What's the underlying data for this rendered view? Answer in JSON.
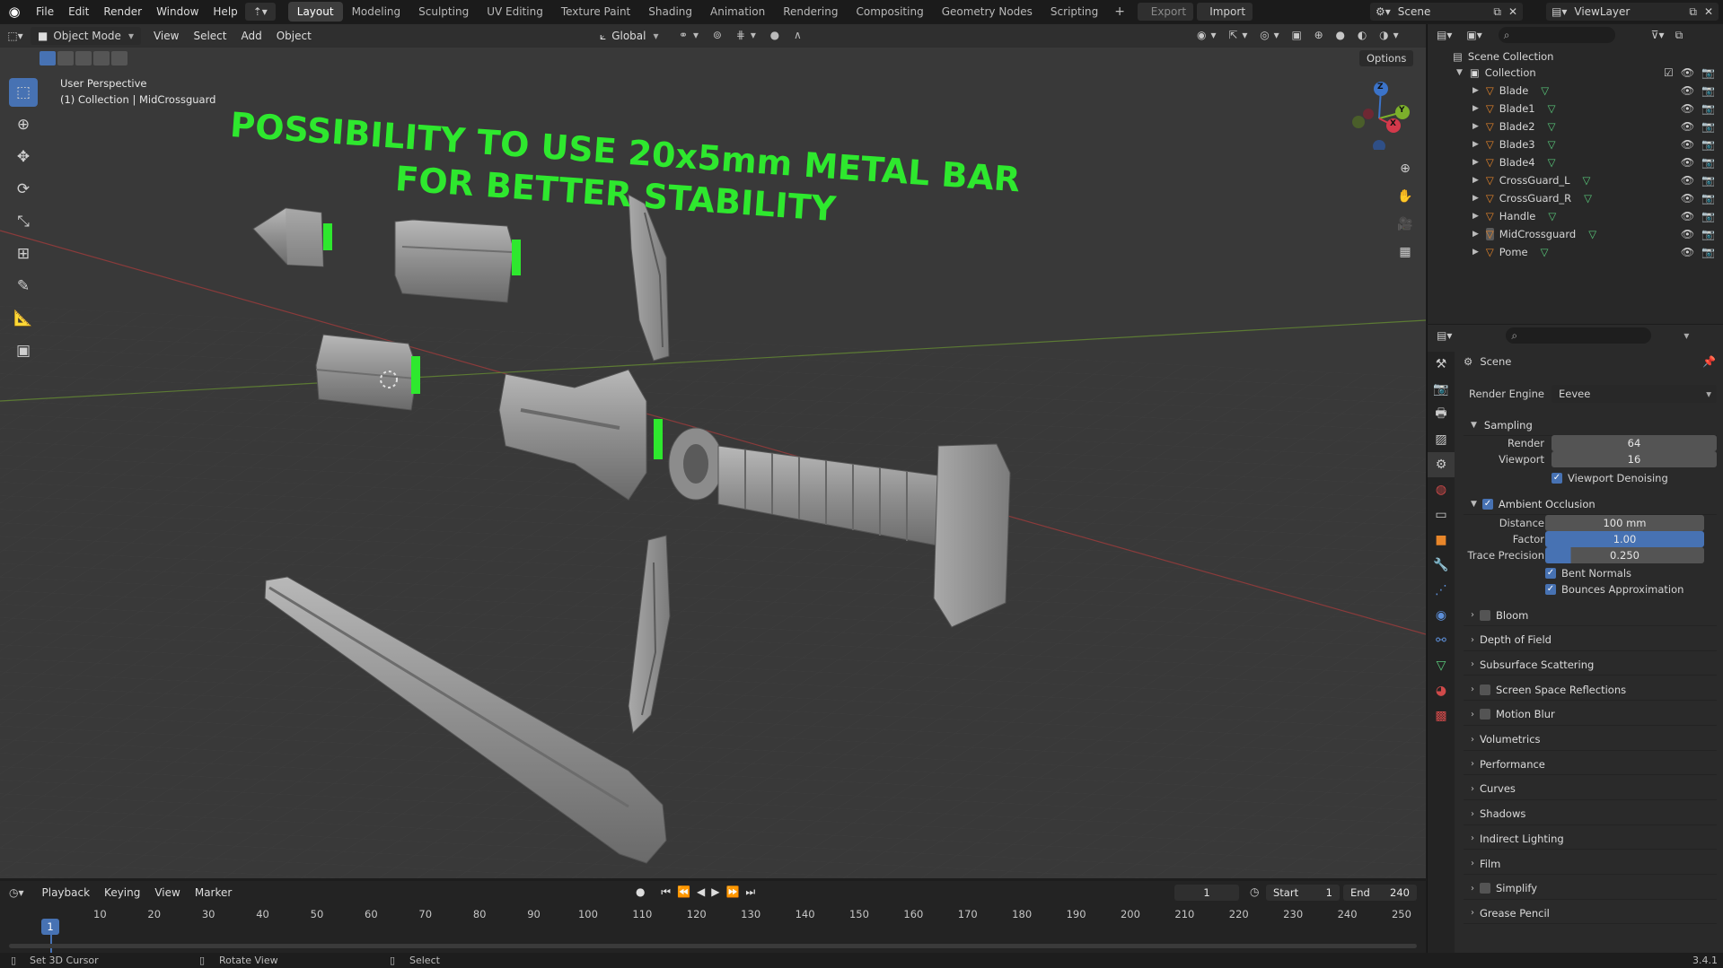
{
  "topbar": {
    "menus": [
      "File",
      "Edit",
      "Render",
      "Window",
      "Help"
    ],
    "workspaces": [
      "Layout",
      "Modeling",
      "Sculpting",
      "UV Editing",
      "Texture Paint",
      "Shading",
      "Animation",
      "Rendering",
      "Compositing",
      "Geometry Nodes",
      "Scripting"
    ],
    "active_workspace": "Layout",
    "export_label": "Export",
    "import_label": "Import",
    "scene_name": "Scene",
    "view_layer": "ViewLayer"
  },
  "viewport": {
    "mode": "Object Mode",
    "menus": [
      "View",
      "Select",
      "Add",
      "Object"
    ],
    "orientation": "Global",
    "options_label": "Options",
    "view_name": "User Perspective",
    "collection_info": "(1) Collection | MidCrossguard",
    "annotation_line1": "POSSIBILITY TO USE 20x5mm METAL BAR",
    "annotation_line2": "FOR BETTER STABILITY",
    "annotation_color": "#2ee82e",
    "gizmo_axes": [
      "Z",
      "Y",
      "X"
    ]
  },
  "outliner": {
    "root": "Scene Collection",
    "collection": "Collection",
    "objects": [
      "Blade",
      "Blade1",
      "Blade2",
      "Blade3",
      "Blade4",
      "CrossGuard_L",
      "CrossGuard_R",
      "Handle",
      "MidCrossguard",
      "Pome"
    ]
  },
  "properties": {
    "context": "Scene",
    "render_engine_label": "Render Engine",
    "render_engine": "Eevee",
    "sampling": {
      "title": "Sampling",
      "render_label": "Render",
      "render": "64",
      "viewport_label": "Viewport",
      "viewport": "16",
      "denoising": "Viewport Denoising"
    },
    "ao": {
      "title": "Ambient Occlusion",
      "distance_label": "Distance",
      "distance": "100 mm",
      "factor_label": "Factor",
      "factor": "1.00",
      "trace_label": "Trace Precision",
      "trace": "0.250",
      "bent_normals": "Bent Normals",
      "bounces": "Bounces Approximation"
    },
    "panels": [
      "Bloom",
      "Depth of Field",
      "Subsurface Scattering",
      "Screen Space Reflections",
      "Motion Blur",
      "Volumetrics",
      "Performance",
      "Curves",
      "Shadows",
      "Indirect Lighting",
      "Film",
      "Simplify",
      "Grease Pencil"
    ]
  },
  "timeline": {
    "menus": [
      "Playback",
      "Keying",
      "View",
      "Marker"
    ],
    "current_frame": "1",
    "start_label": "Start",
    "start": "1",
    "end_label": "End",
    "end": "240",
    "ticks": [
      "1",
      "10",
      "20",
      "30",
      "40",
      "50",
      "60",
      "70",
      "80",
      "90",
      "100",
      "110",
      "120",
      "130",
      "140",
      "150",
      "160",
      "170",
      "180",
      "190",
      "200",
      "210",
      "220",
      "230",
      "240",
      "250"
    ]
  },
  "status": {
    "left": "Set 3D Cursor",
    "middle": "Rotate View",
    "right": "Select",
    "version": "3.4.1"
  },
  "colors": {
    "accent": "#4772b3",
    "object_orange": "#e8862a",
    "mesh_green": "#59c87a"
  }
}
